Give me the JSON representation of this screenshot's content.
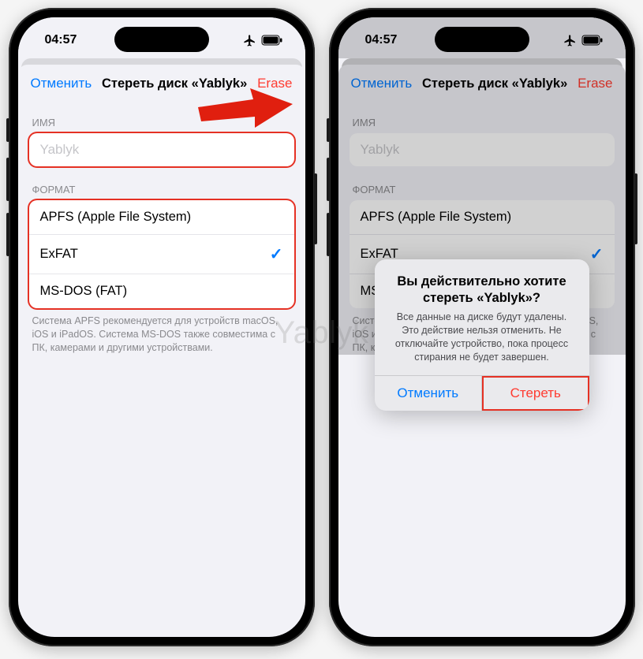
{
  "statusbar": {
    "time": "04:57"
  },
  "navbar": {
    "cancel": "Отменить",
    "title_left": "Стереть диск «Yablyk»",
    "title_right": "Стереть диск «Yablyk»",
    "erase": "Erase"
  },
  "name_section": {
    "label": "ИМЯ",
    "placeholder": "Yablyk"
  },
  "format_section": {
    "label": "ФОРМАТ",
    "options": [
      {
        "label": "APFS (Apple File System)",
        "selected": false
      },
      {
        "label": "ExFAT",
        "selected": true
      },
      {
        "label": "MS-DOS (FAT)",
        "selected": false
      }
    ],
    "footer": "Система APFS рекомендуется для устройств macOS, iOS и iPadOS. Система MS-DOS также совместима с ПК, камерами и другими устройствами."
  },
  "alert": {
    "title": "Вы действительно хотите стереть «Yablyk»?",
    "message": "Все данные на диске будут удалены. Это действие нельзя отменить. Не отключайте устройство, пока процесс стирания не будет завершен.",
    "cancel": "Отменить",
    "confirm": "Стереть"
  },
  "watermark": "Yablyk"
}
